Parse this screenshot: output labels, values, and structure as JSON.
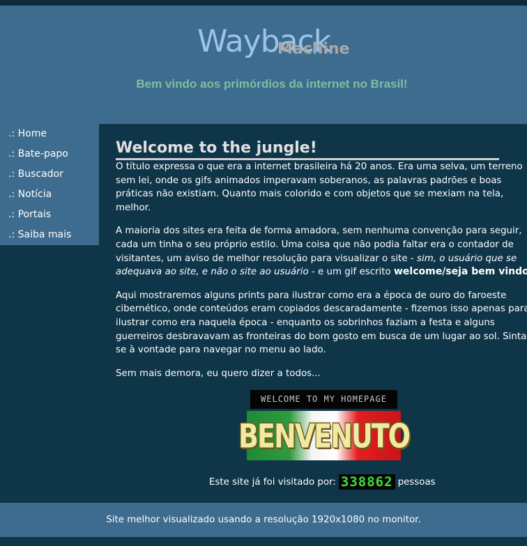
{
  "header": {
    "logo_word1": "Wayback",
    "logo_word2": "Machine",
    "tagline": "Bem vindo aos primórdios da internet no Brasil!"
  },
  "sidebar": {
    "items": [
      {
        "label": ".: Home"
      },
      {
        "label": ".: Bate-papo"
      },
      {
        "label": ".: Buscador"
      },
      {
        "label": ".: Notícia"
      },
      {
        "label": ".: Portais"
      },
      {
        "label": ".: Saiba mais"
      }
    ]
  },
  "main": {
    "title": "Welcome to the jungle!",
    "p1": "O título expressa o que era a internet brasileira há 20 anos. Era uma selva, um terreno sem lei, onde os gifs animados imperavam soberanos, as palavras padrões e boas práticas não existiam. Quanto mais colorido e com objetos que se mexiam na tela, melhor.",
    "p2_start": "A maioria dos sites era feita de forma amadora, sem nenhuma convenção para seguir, cada um tinha o seu próprio estilo. Uma coisa que não podia faltar era o contador de visitantes, um aviso de melhor resolução para visualizar o site - ",
    "p2_italic": "sim, o usuário que se adequava ao site, e não o site ao usuário",
    "p2_mid": " - e um gif escrito ",
    "p2_bold": "welcome/seja bem vindo",
    "p2_end": ".",
    "p3": "Aqui mostraremos alguns prints para ilustrar como era a época de ouro do faroeste cibernético, onde conteúdos eram copiados descaradamente - fizemos isso apenas para ilustrar como era naquela época - enquanto os sobrinhos faziam a festa e alguns guerreiros desbravavam as fronteiras do bom gosto em busca de um lugar ao sol. Sinta-se à vontade para navegar no menu ao lado.",
    "p4": "Sem mais demora, eu quero dizer a todos..."
  },
  "banners": {
    "welcome": "WELCOME TO MY HOMEPAGE",
    "benvenuto": "BENVENUTO"
  },
  "visits": {
    "prefix": "Este site já foi visitado por:",
    "count": "338862",
    "suffix": "pessoas"
  },
  "footer": {
    "text": "Site melhor visualizado usando a resolução 1920x1080 no monitor."
  },
  "colors": {
    "background": "#0f3549",
    "panel": "#3e6c8e",
    "tagline": "#7cbfa6",
    "logo": "#9cc3e8",
    "counter_digits": "#3ae23a"
  }
}
